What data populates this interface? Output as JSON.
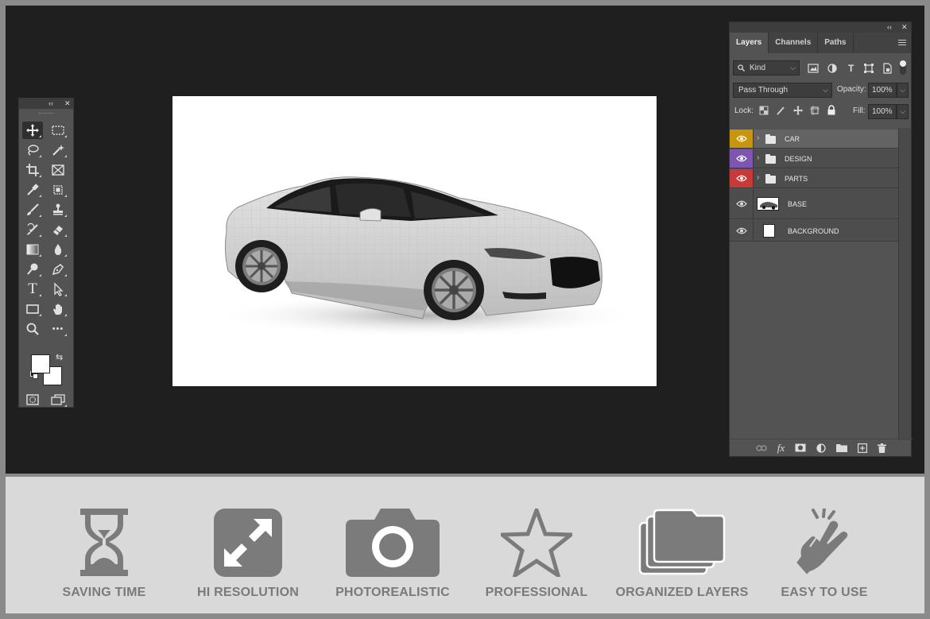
{
  "tools_panel": {
    "collapse_label": "‹‹",
    "close_label": "✕",
    "tools": [
      "move-tool-icon",
      "marquee-tool-icon",
      "lasso-tool-icon",
      "magic-wand-tool-icon",
      "crop-tool-icon",
      "frame-tool-icon",
      "eyedropper-tool-icon",
      "patch-tool-icon",
      "brush-tool-icon",
      "stamp-tool-icon",
      "history-brush-tool-icon",
      "eraser-tool-icon",
      "gradient-tool-icon",
      "blur-tool-icon",
      "dodge-tool-icon",
      "pen-tool-icon",
      "type-tool-icon",
      "path-selection-tool-icon",
      "rectangle-tool-icon",
      "hand-tool-icon",
      "zoom-tool-icon",
      "more-tools-icon"
    ],
    "type_glyph": "T",
    "more_glyph": "•••"
  },
  "layers_panel": {
    "collapse_label": "‹‹",
    "close_label": "✕",
    "tabs": [
      {
        "label": "Layers",
        "active": true
      },
      {
        "label": "Channels",
        "active": false
      },
      {
        "label": "Paths",
        "active": false
      }
    ],
    "filter": {
      "label": "Kind",
      "icon": "search-icon"
    },
    "filter_type_glyph": "T",
    "blend_mode": "Pass Through",
    "opacity_label": "Opacity:",
    "opacity_value": "100%",
    "lock_label": "Lock:",
    "fill_label": "Fill:",
    "fill_value": "100%",
    "layers": [
      {
        "name": "CAR",
        "type": "group",
        "color": "#c8960c"
      },
      {
        "name": "DESIGN",
        "type": "group",
        "color": "#7e56b1"
      },
      {
        "name": "PARTS",
        "type": "group",
        "color": "#c83a3a"
      },
      {
        "name": "BASE",
        "type": "smart",
        "color": ""
      },
      {
        "name": "BACKGROUND",
        "type": "fill",
        "color": ""
      }
    ],
    "bottom_icons": [
      "link-icon",
      "fx-icon",
      "mask-icon",
      "adjustment-icon",
      "folder-icon",
      "new-layer-icon",
      "trash-icon"
    ],
    "fx_label": "fx"
  },
  "features": [
    {
      "label": "SAVING TIME",
      "icon": "hourglass-icon"
    },
    {
      "label": "HI RESOLUTION",
      "icon": "expand-arrows-icon"
    },
    {
      "label": "PHOTOREALISTIC",
      "icon": "camera-icon"
    },
    {
      "label": "PROFESSIONAL",
      "icon": "star-icon"
    },
    {
      "label": "ORGANIZED LAYERS",
      "icon": "folders-icon"
    },
    {
      "label": "EASY TO USE",
      "icon": "tap-hand-icon"
    }
  ],
  "colors": {
    "workspace": "#1f1f1f",
    "panel": "#535353",
    "feature_text": "#7a7a7a",
    "feature_icon": "#7b7b7b"
  }
}
